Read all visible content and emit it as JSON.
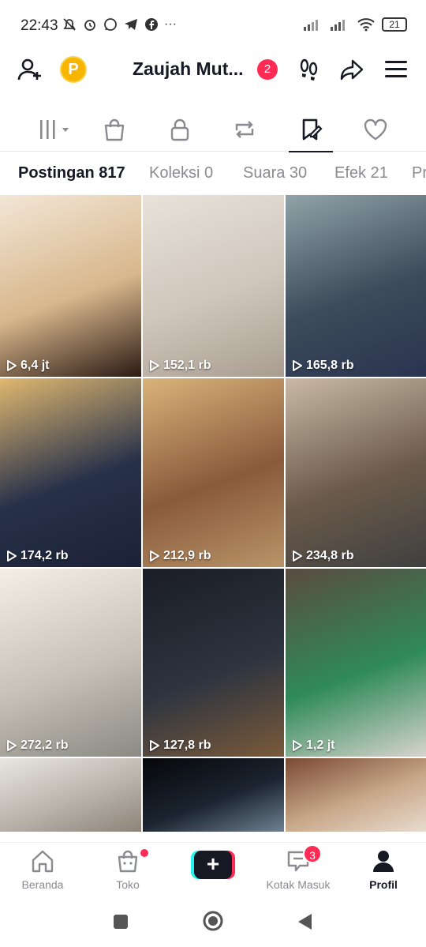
{
  "status_bar": {
    "time": "22:43",
    "left_icons": [
      "mute-icon",
      "alarm-icon",
      "whatsapp-icon",
      "telegram-icon",
      "facebook-icon",
      "more-icon"
    ],
    "more": "···",
    "battery": "21"
  },
  "header": {
    "username": "Zaujah Mut...",
    "notification_count": "2",
    "coin_letter": "P"
  },
  "icon_tabs": [
    "videos-grid-icon",
    "shop-bag-icon",
    "lock-icon",
    "repost-icon",
    "bookmark-icon",
    "heart-icon"
  ],
  "active_icon_tab": 4,
  "text_tabs": [
    "Postingan 817",
    "Koleksi 0",
    "Suara 30",
    "Efek 21",
    "Pr"
  ],
  "videos": [
    {
      "views": "6,4 jt",
      "colors": [
        "#f2e6d6",
        "#d8b78c",
        "#2b1a14"
      ]
    },
    {
      "views": "152,1 rb",
      "colors": [
        "#e8e2da",
        "#cfc6bb",
        "#a99d90"
      ]
    },
    {
      "views": "165,8 rb",
      "colors": [
        "#8fa3a8",
        "#3d4b5a",
        "#2a3450"
      ]
    },
    {
      "views": "174,2 rb",
      "colors": [
        "#e0b870",
        "#27314a",
        "#1c2236"
      ]
    },
    {
      "views": "212,9 rb",
      "colors": [
        "#d9b37a",
        "#8a5a3b",
        "#b89468"
      ]
    },
    {
      "views": "234,8 rb",
      "colors": [
        "#c9b9a6",
        "#6b5a4a",
        "#3f4040"
      ]
    },
    {
      "views": "272,2 rb",
      "colors": [
        "#f4efe6",
        "#c7c0b6",
        "#8a8a84"
      ]
    },
    {
      "views": "127,8 rb",
      "colors": [
        "#1a1d26",
        "#2d3440",
        "#7a5a3a"
      ]
    },
    {
      "views": "1,2 jt",
      "colors": [
        "#5a4b40",
        "#2f8a5a",
        "#d8d4cc"
      ]
    },
    {
      "views": "",
      "colors": [
        "#e9e7e2",
        "#b9b3aa",
        "#8d8479"
      ]
    },
    {
      "views": "",
      "colors": [
        "#06070a",
        "#1b2430",
        "#6f8090"
      ]
    },
    {
      "views": "",
      "colors": [
        "#7a4a32",
        "#c9a88a",
        "#e8dccf"
      ]
    }
  ],
  "bottom_nav": [
    {
      "label": "Beranda",
      "icon": "home-icon"
    },
    {
      "label": "Toko",
      "icon": "shop-icon"
    },
    {
      "label": "",
      "icon": "create-icon"
    },
    {
      "label": "Kotak Masuk",
      "icon": "inbox-icon",
      "badge": "3"
    },
    {
      "label": "Profil",
      "icon": "profile-icon"
    }
  ]
}
